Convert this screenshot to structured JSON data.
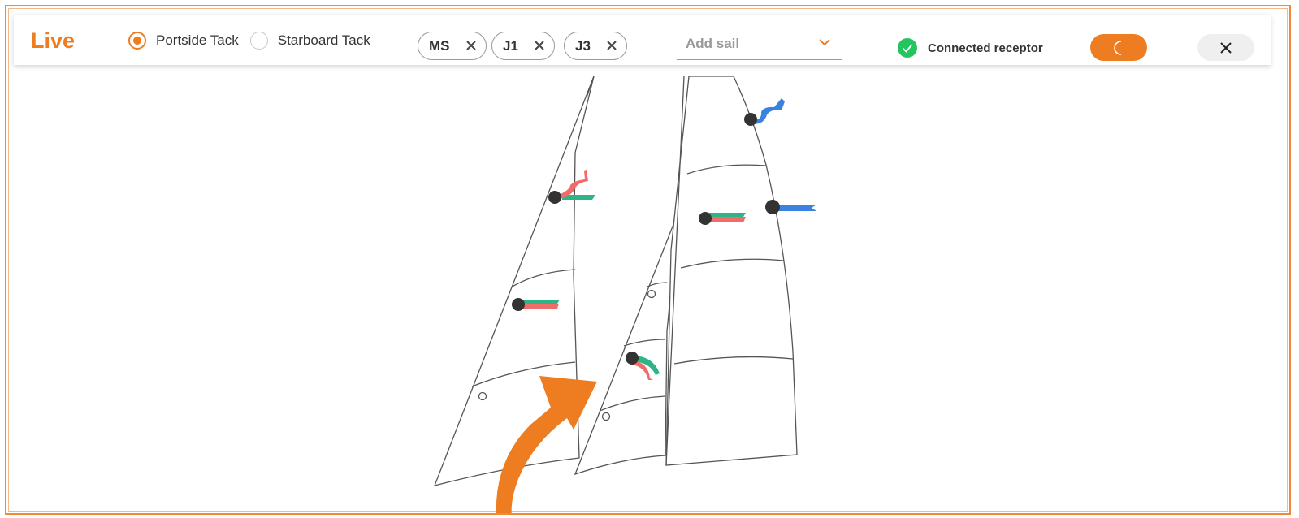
{
  "app": {
    "title": "Live"
  },
  "tack": {
    "options": [
      {
        "label": "Portside Tack",
        "selected": true
      },
      {
        "label": "Starboard Tack",
        "selected": false
      }
    ]
  },
  "sails": {
    "chips": [
      {
        "label": "MS"
      },
      {
        "label": "J1"
      },
      {
        "label": "J3"
      }
    ],
    "add_placeholder": "Add sail"
  },
  "status": {
    "label": "Connected receptor",
    "color": "#22c55e"
  },
  "colors": {
    "accent": "#ee7d22",
    "telltale_red": "#f26b6b",
    "telltale_green": "#2fb585",
    "telltale_blue": "#3b82e0"
  },
  "icons": {
    "night": "moon-icon",
    "close": "close-icon",
    "dropdown": "chevron-down-icon",
    "status": "check-circle-icon"
  }
}
